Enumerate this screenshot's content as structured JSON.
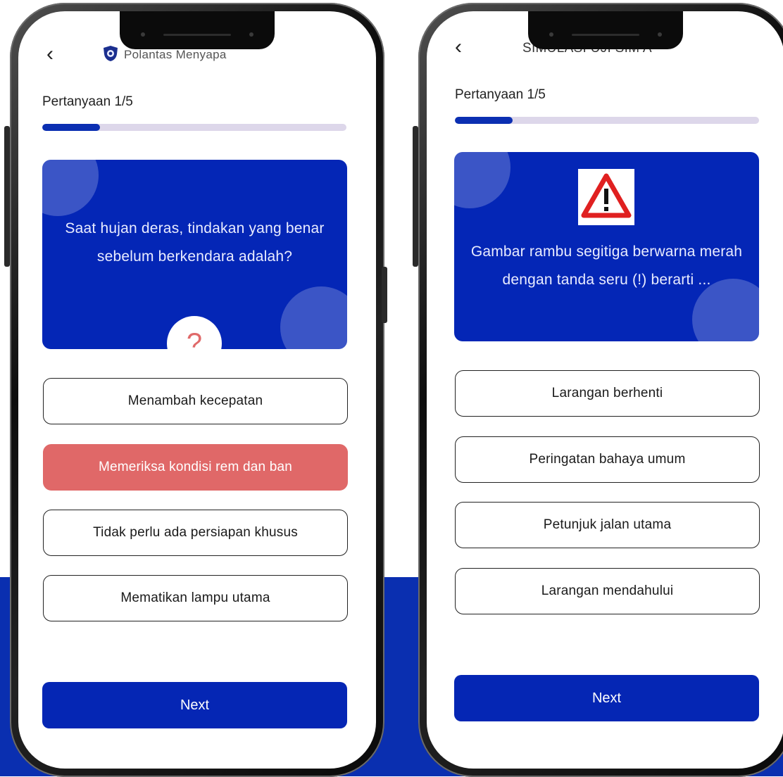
{
  "colors": {
    "brand_blue": "#0426b6",
    "selected_red": "#e06868",
    "progress_track": "#ddd7ea"
  },
  "left_phone": {
    "header": {
      "back_icon": "chevron-left-icon",
      "logo_icon": "police-badge-icon",
      "title": "Polantas Menyapa"
    },
    "question_counter": "Pertanyaan 1/5",
    "progress_fraction": 0.19,
    "question_text": "Saat hujan deras, tindakan yang benar sebelum berkendara adalah?",
    "badge_symbol": "?",
    "options": [
      {
        "label": "Menambah kecepatan",
        "selected": false
      },
      {
        "label": "Memeriksa kondisi rem dan ban",
        "selected": true
      },
      {
        "label": "Tidak perlu ada persiapan khusus",
        "selected": false
      },
      {
        "label": "Mematikan lampu utama",
        "selected": false
      }
    ],
    "next_label": "Next"
  },
  "right_phone": {
    "header": {
      "back_icon": "chevron-left-icon",
      "title": "SIMULASI UJI SIM A"
    },
    "question_counter": "Pertanyaan 1/5",
    "progress_fraction": 0.19,
    "sign_icon": "warning-triangle-icon",
    "question_text": "Gambar rambu segitiga berwarna merah dengan tanda seru (!) berarti ...",
    "options": [
      {
        "label": "Larangan berhenti",
        "selected": false
      },
      {
        "label": "Peringatan bahaya umum",
        "selected": false
      },
      {
        "label": "Petunjuk jalan utama",
        "selected": false
      },
      {
        "label": "Larangan mendahului",
        "selected": false
      }
    ],
    "next_label": "Next"
  }
}
